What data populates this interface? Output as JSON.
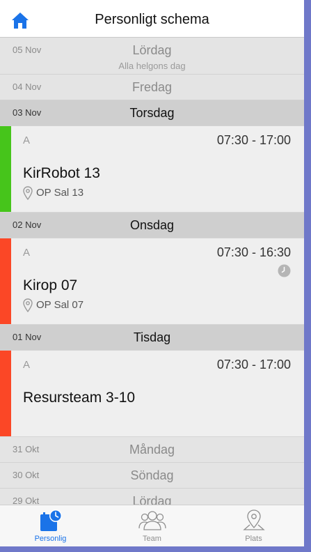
{
  "header": {
    "title": "Personligt schema"
  },
  "days": [
    {
      "date": "05 Nov",
      "weekday": "Lördag",
      "subtitle": "Alla helgons dag"
    },
    {
      "date": "04 Nov",
      "weekday": "Fredag"
    },
    {
      "date": "03 Nov",
      "weekday": "Torsdag"
    },
    {
      "date": "02 Nov",
      "weekday": "Onsdag"
    },
    {
      "date": "01 Nov",
      "weekday": "Tisdag"
    },
    {
      "date": "31 Okt",
      "weekday": "Måndag"
    },
    {
      "date": "30 Okt",
      "weekday": "Söndag"
    },
    {
      "date": "29 Okt",
      "weekday": "Lördag"
    }
  ],
  "shifts": [
    {
      "code": "A",
      "time": "07:30 - 17:00",
      "name": "KirRobot 13",
      "location": "OP Sal 13",
      "color": "#46c51b"
    },
    {
      "code": "A",
      "time": "07:30 - 16:30",
      "name": "Kirop 07",
      "location": "OP Sal 07",
      "color": "#fb4726"
    },
    {
      "code": "A",
      "time": "07:30 - 17:00",
      "name": "Resursteam 3-10",
      "color": "#fb4726"
    }
  ],
  "tabs": [
    {
      "label": "Personlig"
    },
    {
      "label": "Team"
    },
    {
      "label": "Plats"
    }
  ],
  "colors": {
    "accent": "#1a73e8",
    "frame": "#6f78c9"
  }
}
